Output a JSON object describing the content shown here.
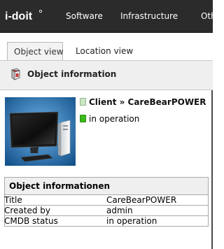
{
  "topbar": {
    "logo_text": "i-doit",
    "nav": [
      "Software",
      "Infrastructure",
      "Other"
    ]
  },
  "tabs": [
    {
      "label": "Object view",
      "active": true
    },
    {
      "label": "Location view",
      "active": false
    }
  ],
  "header": {
    "title": "Object information"
  },
  "object": {
    "title": "Client » CareBearPOWER",
    "status": "in operation",
    "type_color": "#c9e7c2",
    "status_color": "#3bbb19"
  },
  "info_table": {
    "heading": "Object informationen",
    "rows": [
      {
        "key": "Title",
        "value": "CareBearPOWER"
      },
      {
        "key": "Created by",
        "value": "admin"
      },
      {
        "key": "CMDB status",
        "value": "in operation"
      }
    ]
  }
}
